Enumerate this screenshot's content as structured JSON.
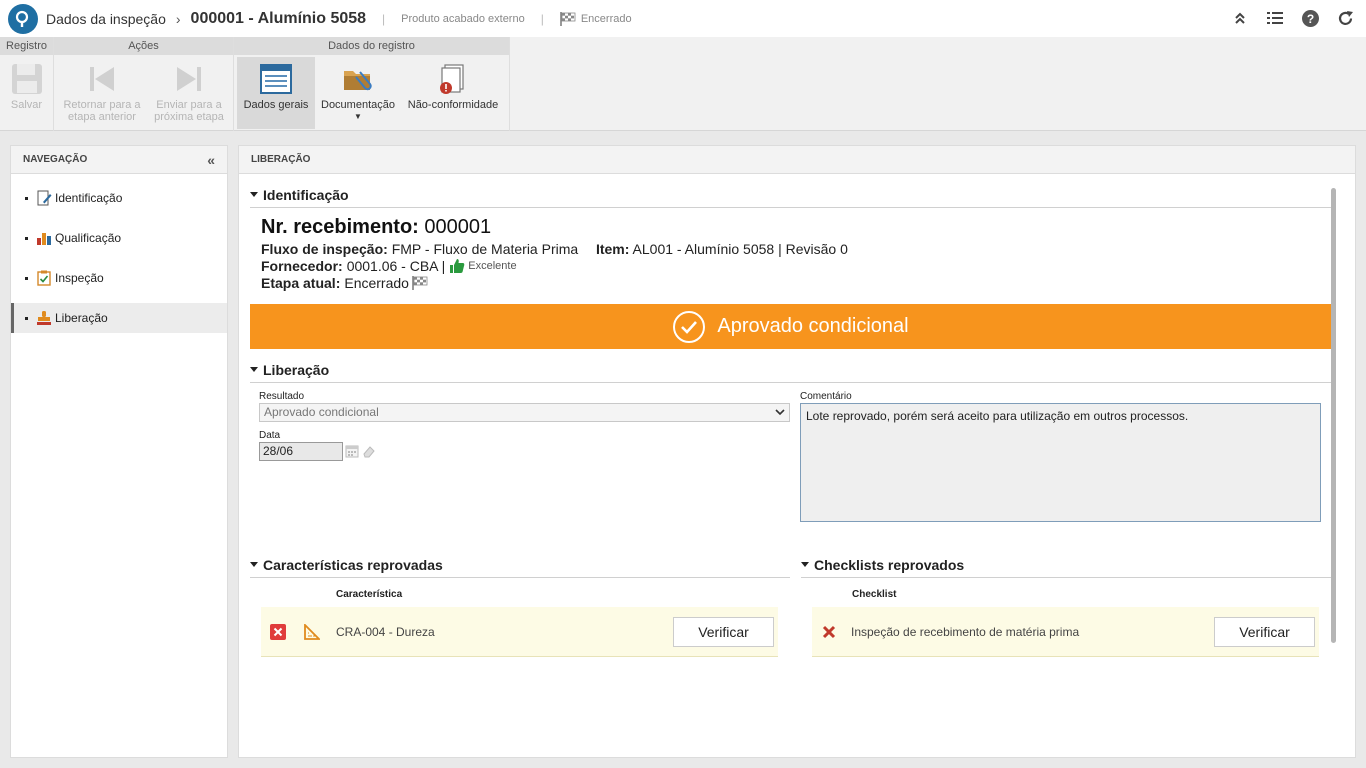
{
  "header": {
    "app_title": "Dados da inspeção",
    "record_title": "000001 - Alumínio 5058",
    "product_type": "Produto acabado externo",
    "status": "Encerrado"
  },
  "toolbar": {
    "groups": {
      "registro": "Registro",
      "acoes": "Ações",
      "dados_registro": "Dados do registro"
    },
    "save": "Salvar",
    "return_prev_1": "Retornar para a",
    "return_prev_2": "etapa anterior",
    "send_next_1": "Enviar para a",
    "send_next_2": "próxima etapa",
    "general_data": "Dados gerais",
    "documentation": "Documentação",
    "nonconformity": "Não-conformidade"
  },
  "nav": {
    "title": "NAVEGAÇÃO",
    "items": [
      {
        "label": "Identificação"
      },
      {
        "label": "Qualificação"
      },
      {
        "label": "Inspeção"
      },
      {
        "label": "Liberação"
      }
    ],
    "selected": "Liberação"
  },
  "main": {
    "title": "LIBERAÇÃO",
    "identification": {
      "section_title": "Identificação",
      "nr_label": "Nr. recebimento:",
      "nr_value": "000001",
      "flow_label": "Fluxo de inspeção:",
      "flow_value": "FMP - Fluxo de Materia Prima",
      "item_label": "Item:",
      "item_value": "AL001 - Alumínio 5058 | Revisão 0",
      "supplier_label": "Fornecedor:",
      "supplier_value": "0001.06 - CBA |",
      "supplier_rating": "Excelente",
      "stage_label": "Etapa atual:",
      "stage_value": "Encerrado"
    },
    "banner": {
      "text": "Aprovado condicional",
      "color": "#f7941d"
    },
    "release": {
      "section_title": "Liberação",
      "result_label": "Resultado",
      "result_value": "Aprovado condicional",
      "date_label": "Data",
      "date_value": "28/06",
      "comment_label": "Comentário",
      "comment_value": "Lote reprovado, porém será aceito para utilização em outros processos."
    },
    "failed_characteristics": {
      "section_title": "Características reprovadas",
      "column": "Característica",
      "rows": [
        {
          "name": "CRA-004 - Dureza",
          "action": "Verificar"
        }
      ]
    },
    "failed_checklists": {
      "section_title": "Checklists reprovados",
      "column": "Checklist",
      "rows": [
        {
          "name": "Inspeção de recebimento de matéria prima",
          "action": "Verificar"
        }
      ]
    }
  }
}
